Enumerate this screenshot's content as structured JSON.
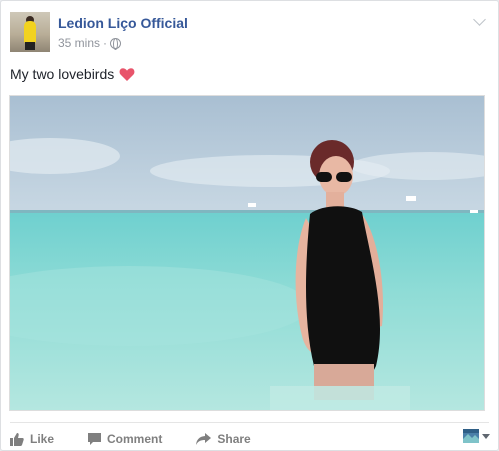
{
  "post": {
    "author": "Ledion Liço Official",
    "timestamp": "35 mins",
    "separator": "·",
    "privacy_icon": "globe-icon",
    "text": "My two lovebirds",
    "emoji": "heart-icon"
  },
  "actions": {
    "like": "Like",
    "comment": "Comment",
    "share": "Share"
  },
  "colors": {
    "author_link": "#365899",
    "heart": "#e8546b",
    "action_text": "#7f7f7f"
  }
}
